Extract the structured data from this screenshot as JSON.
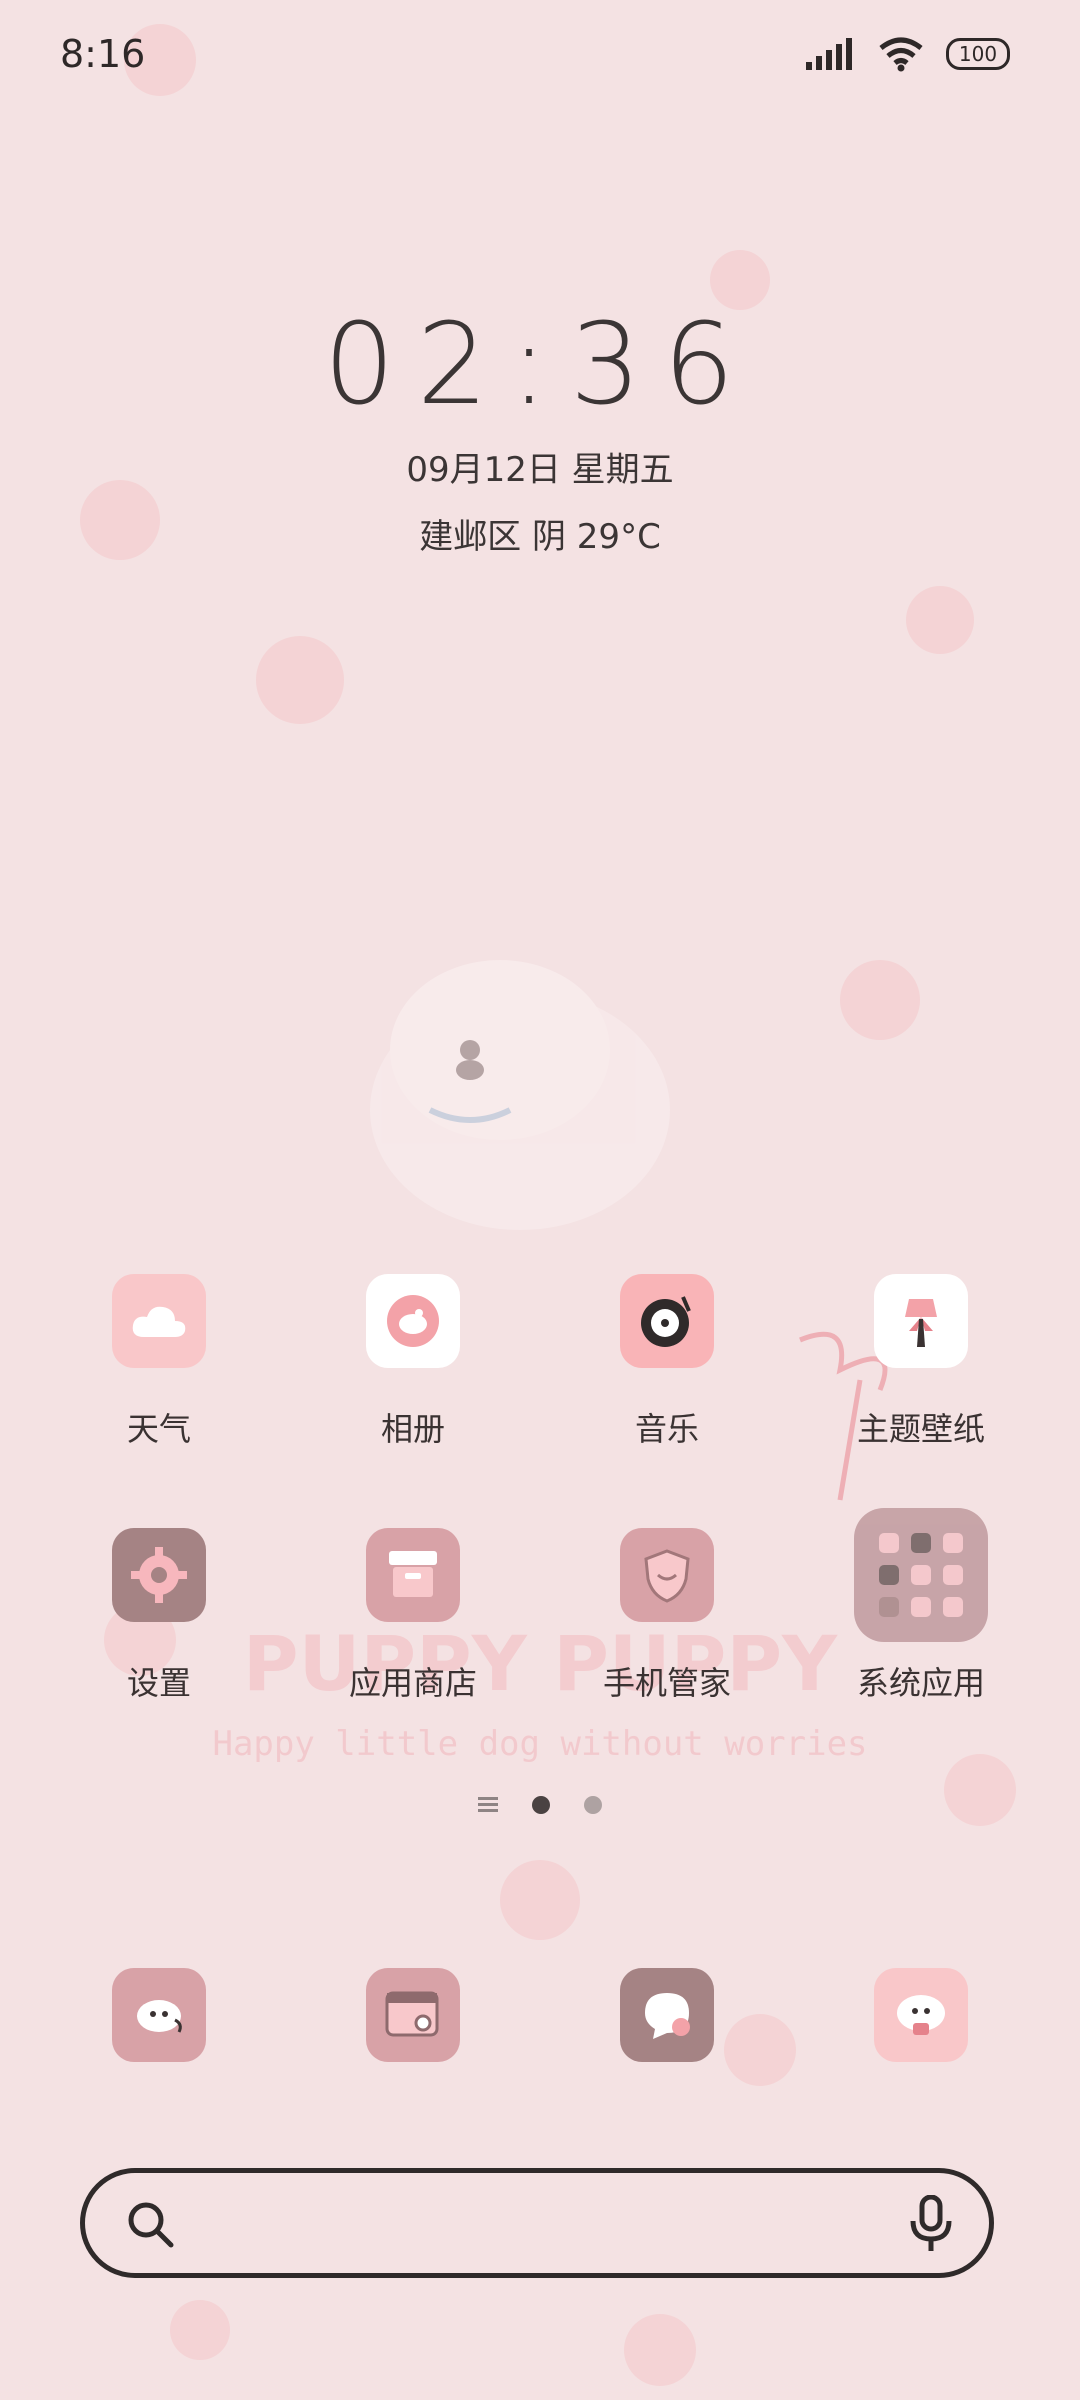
{
  "status_bar": {
    "time": "8:16",
    "battery": "100",
    "icons": [
      "signal-icon",
      "wifi-icon",
      "battery-icon"
    ]
  },
  "clock_widget": {
    "time": "02:36",
    "date": "09月12日 星期五",
    "weather": "建邺区 阴 29°C"
  },
  "apps": [
    {
      "label": "天气",
      "icon": "weather-cloud-icon"
    },
    {
      "label": "相册",
      "icon": "gallery-icon"
    },
    {
      "label": "音乐",
      "icon": "music-record-icon"
    },
    {
      "label": "主题壁纸",
      "icon": "themes-icon"
    },
    {
      "label": "设置",
      "icon": "settings-gear-icon"
    },
    {
      "label": "应用商店",
      "icon": "app-store-icon"
    },
    {
      "label": "手机管家",
      "icon": "security-shield-icon"
    },
    {
      "label": "系统应用",
      "icon": "system-apps-folder-icon"
    }
  ],
  "page_indicator": {
    "pages": 3,
    "active": 1
  },
  "dock": [
    {
      "icon": "phone-dog-icon"
    },
    {
      "icon": "browser-icon"
    },
    {
      "icon": "messages-icon"
    },
    {
      "icon": "camera-dog-icon"
    }
  ],
  "colors": {
    "background": "#f4e2e3",
    "icon_pink": "#f9c7c9",
    "icon_rose": "#d8a2a7",
    "icon_mauve": "#a58384"
  }
}
